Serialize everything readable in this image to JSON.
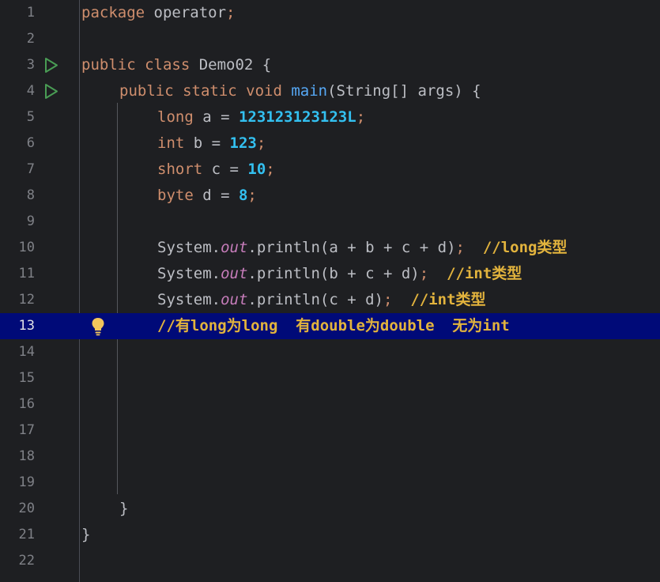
{
  "editor": {
    "current_line": 13,
    "lines": [
      {
        "num": "1"
      },
      {
        "num": "2"
      },
      {
        "num": "3"
      },
      {
        "num": "4"
      },
      {
        "num": "5"
      },
      {
        "num": "6"
      },
      {
        "num": "7"
      },
      {
        "num": "8"
      },
      {
        "num": "9"
      },
      {
        "num": "10"
      },
      {
        "num": "11"
      },
      {
        "num": "12"
      },
      {
        "num": "13"
      },
      {
        "num": "14"
      },
      {
        "num": "15"
      },
      {
        "num": "16"
      },
      {
        "num": "17"
      },
      {
        "num": "18"
      },
      {
        "num": "19"
      },
      {
        "num": "20"
      },
      {
        "num": "21"
      },
      {
        "num": "22"
      }
    ],
    "code": {
      "l1_kw": "package",
      "l1_name": " operator",
      "l1_semi": ";",
      "l3_kw": "public class",
      "l3_rest": " Demo02 {",
      "l4_kw": "public static void",
      "l4_fn": " main",
      "l4_rest": "(String[] args) {",
      "l5_kw": "long",
      "l5_mid": " a = ",
      "l5_num": "123123123123L",
      "l5_semi": ";",
      "l6_kw": "int",
      "l6_mid": " b = ",
      "l6_num": "123",
      "l6_semi": ";",
      "l7_kw": "short",
      "l7_mid": " c = ",
      "l7_num": "10",
      "l7_semi": ";",
      "l8_kw": "byte",
      "l8_mid": " d = ",
      "l8_num": "8",
      "l8_semi": ";",
      "sys": "System.",
      "out": "out",
      "println": ".println(",
      "l10_args": "a + b + c + d)",
      "l10_cmt": "//long类型",
      "l11_args": "b + c + d)",
      "l11_cmt": "//int类型",
      "l12_args": "c + d)",
      "l12_cmt": "//int类型",
      "l13_cmt": "//有long为long  有double为double  无为int",
      "l20_text": "}",
      "l21_text": "}",
      "semi": ";"
    }
  },
  "colors": {
    "background": "#1e1f22",
    "current_line": "#000a78",
    "keyword": "#cf8e6d",
    "number": "#2aacb8",
    "comment": "#e2b33d",
    "static_field": "#c77dbb",
    "run_icon": "#499c54",
    "bulb_icon": "#f2c55c"
  }
}
